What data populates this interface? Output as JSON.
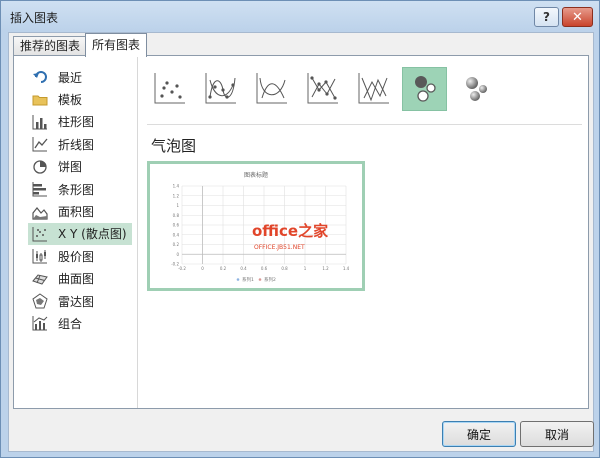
{
  "window": {
    "title": "插入图表",
    "help_label": "?",
    "close_label": "✕"
  },
  "tabs": [
    {
      "label": "推荐的图表"
    },
    {
      "label": "所有图表"
    }
  ],
  "sidebar": {
    "items": [
      {
        "label": "最近",
        "icon": "undo-arrow-icon"
      },
      {
        "label": "模板",
        "icon": "folder-icon"
      },
      {
        "label": "柱形图",
        "icon": "column-chart-icon"
      },
      {
        "label": "折线图",
        "icon": "line-chart-icon"
      },
      {
        "label": "饼图",
        "icon": "pie-chart-icon"
      },
      {
        "label": "条形图",
        "icon": "bar-chart-icon"
      },
      {
        "label": "面积图",
        "icon": "area-chart-icon"
      },
      {
        "label": "X Y (散点图)",
        "icon": "scatter-chart-icon"
      },
      {
        "label": "股价图",
        "icon": "stock-chart-icon"
      },
      {
        "label": "曲面图",
        "icon": "surface-chart-icon"
      },
      {
        "label": "雷达图",
        "icon": "radar-chart-icon"
      },
      {
        "label": "组合",
        "icon": "combo-chart-icon"
      }
    ],
    "selected_index": 7
  },
  "subtypes": {
    "items": [
      {
        "icon": "scatter-markers-icon"
      },
      {
        "icon": "scatter-smooth-markers-icon"
      },
      {
        "icon": "scatter-smooth-icon"
      },
      {
        "icon": "scatter-straight-markers-icon"
      },
      {
        "icon": "scatter-straight-icon"
      },
      {
        "icon": "bubble-icon"
      },
      {
        "icon": "bubble-3d-icon"
      }
    ],
    "selected_index": 5,
    "section_title": "气泡图"
  },
  "preview": {
    "watermark_main": "office之家",
    "watermark_sub": "OFFICE.JB51.NET",
    "chart_data": {
      "type": "scatter",
      "title": "图表标题",
      "xlabel": "",
      "ylabel": "",
      "xlim": [
        -0.2,
        1.4
      ],
      "ylim": [
        -0.2,
        1.4
      ],
      "x_ticks": [
        "-0.2",
        "0",
        "0.2",
        "0.4",
        "0.6",
        "0.8",
        "1",
        "1.2",
        "1.4"
      ],
      "y_ticks": [
        "1.4",
        "1.2",
        "1",
        "0.8",
        "0.6",
        "0.4",
        "0.2",
        "0",
        "-0.2"
      ],
      "series": [
        {
          "name": "系列1",
          "values": []
        },
        {
          "name": "系列2",
          "values": []
        }
      ],
      "legend": "bottom",
      "grid": true
    }
  },
  "footer": {
    "ok_label": "确定",
    "cancel_label": "取消"
  }
}
